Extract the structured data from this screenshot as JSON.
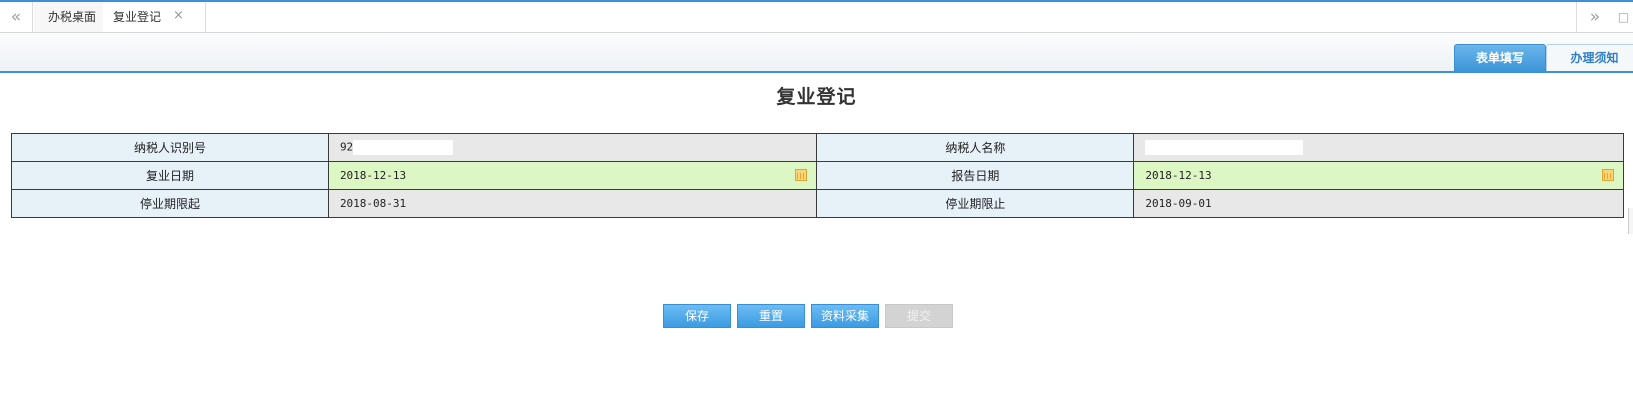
{
  "tabs": {
    "nav_prev": "«",
    "nav_next": "»",
    "extra": "□",
    "items": [
      {
        "label": "办税桌面"
      },
      {
        "label": "复业登记",
        "close": "×"
      }
    ]
  },
  "subtabs": {
    "active": "表单填写",
    "inactive": "办理须知"
  },
  "form": {
    "title": "复业登记",
    "rows": [
      {
        "label1": "纳税人识别号",
        "value1": "92",
        "label2": "纳税人名称",
        "value2": ""
      },
      {
        "label1": "复业日期",
        "value1": "2018-12-13",
        "label2": "报告日期",
        "value2": "2018-12-13"
      },
      {
        "label1": "停业期限起",
        "value1": "2018-08-31",
        "label2": "停业期限止",
        "value2": "2018-09-01"
      }
    ]
  },
  "buttons": {
    "save": "保存",
    "reset": "重置",
    "collect": "资料采集",
    "submit": "提交"
  },
  "colors": {
    "accent": "#3b93d6",
    "label_bg": "#e6f1f8",
    "editable_bg": "#ddf7c4",
    "readonly_bg": "#e8e8e8",
    "disabled_button": "#d3d3d3"
  }
}
